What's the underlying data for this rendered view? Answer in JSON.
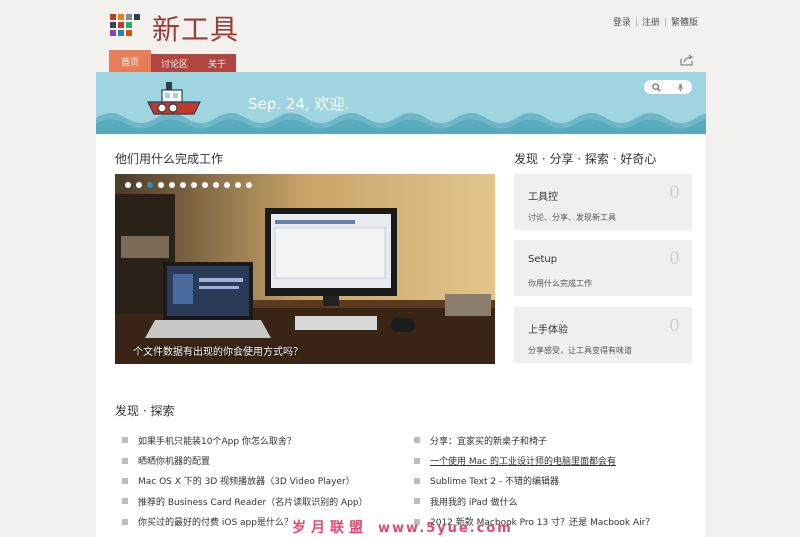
{
  "header": {
    "site_title": "新工具",
    "links": [
      "登录",
      "注册",
      "繁體版"
    ]
  },
  "tabs": [
    "首页",
    "讨论区",
    "关于"
  ],
  "banner": {
    "welcome": "Sep. 24, 欢迎."
  },
  "featured": {
    "title": "他们用什么完成工作",
    "caption": "个文件数据有出现的你会使用方式吗？",
    "dot_count": 12,
    "active_dot": 2
  },
  "discover": {
    "title": "发现 · 分享 · 探索 · 好奇心",
    "cards": [
      {
        "title": "工具控",
        "subtitle": "讨论、分享、发现新工具",
        "count": "0"
      },
      {
        "title": "Setup",
        "subtitle": "你用什么完成工作",
        "count": "0"
      },
      {
        "title": "上手体验",
        "subtitle": "分享感受，让工具变得有味道",
        "count": "0"
      }
    ]
  },
  "explore": {
    "title": "发现 · 探索",
    "left": [
      "如果手机只能装10个App 你怎么取舍？",
      "晒晒你机器的配置",
      "Mac OS X 下的 3D 视频播放器（3D Video Player）",
      "推荐的 Business Card Reader（名片读取识别的 App）",
      "你买过的最好的付费 iOS app是什么？"
    ],
    "right": [
      "分享：宜家买的新桌子和椅子",
      "一个使用 Mac 的工业设计师的电脑里面都会有",
      "Sublime Text 2 - 不错的编辑器",
      "我用我的 iPad 做什么",
      "2012 新款 Macbook Pro 13 寸？还是 Macbook Air？"
    ]
  },
  "watermark": {
    "text1": "岁月联盟",
    "text2": "www.5yue.com"
  },
  "colors": {
    "brand": "#9a3b36",
    "tab_active": "#e67e5a",
    "tab": "#b04641",
    "banner": "#9fd5e1",
    "dot_active": "#2b8fc4"
  }
}
